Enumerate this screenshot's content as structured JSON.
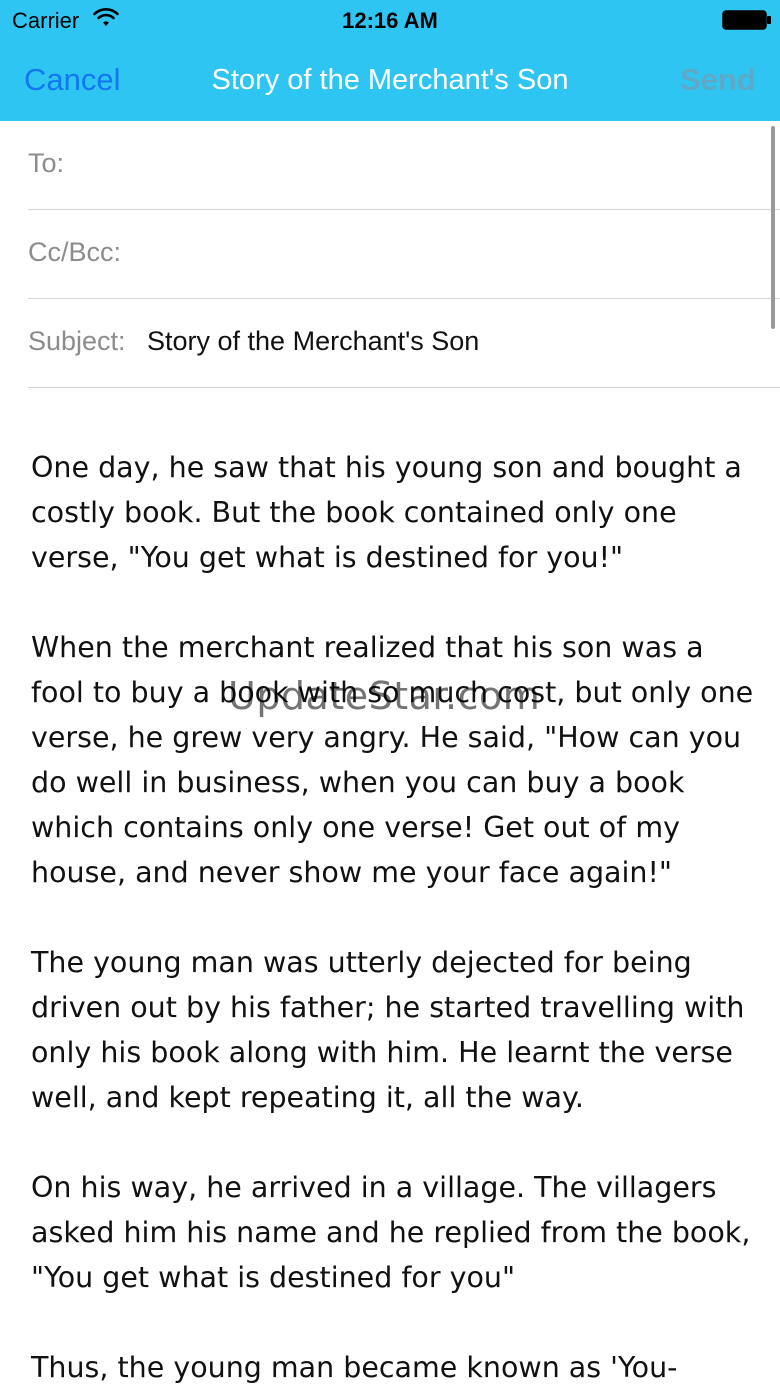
{
  "status_bar": {
    "carrier": "Carrier",
    "time": "12:16 AM",
    "wifi_icon": "wifi-icon",
    "battery_icon": "battery-icon"
  },
  "nav": {
    "cancel_label": "Cancel",
    "title": "Story of the Merchant's Son",
    "send_label": "Send"
  },
  "fields": {
    "to_label": "To:",
    "to_value": "",
    "cc_label": "Cc/Bcc:",
    "cc_value": "",
    "subject_label": "Subject:",
    "subject_value": "Story of the Merchant's Son"
  },
  "body": {
    "paragraphs": [
      "One day, he saw that his young son and bought a costly book. But the book contained only one verse, \"You get what is destined for you!\"",
      "When the merchant realized that his son was a fool to buy a book with so much cost, but only one verse, he grew very angry. He said, \"How can you do well in business, when you can buy a book which contains only one verse! Get out of my house, and never show me your face again!\"",
      "The young man was utterly dejected for being driven out by his father; he started travelling with only his book along with him. He learnt the verse well, and kept repeating it, all the way.",
      "On his way, he arrived in a village. The villagers asked him his name and he replied from the book, \"You get what is destined for you\"",
      "Thus, the young man became known as 'You-"
    ]
  },
  "watermark": "UpdateStar.com",
  "colors": {
    "nav_background": "#2fc5f3",
    "cancel_text": "#1278f0",
    "send_text_disabled": "#5ea9c7",
    "title_text": "#ffffff"
  }
}
